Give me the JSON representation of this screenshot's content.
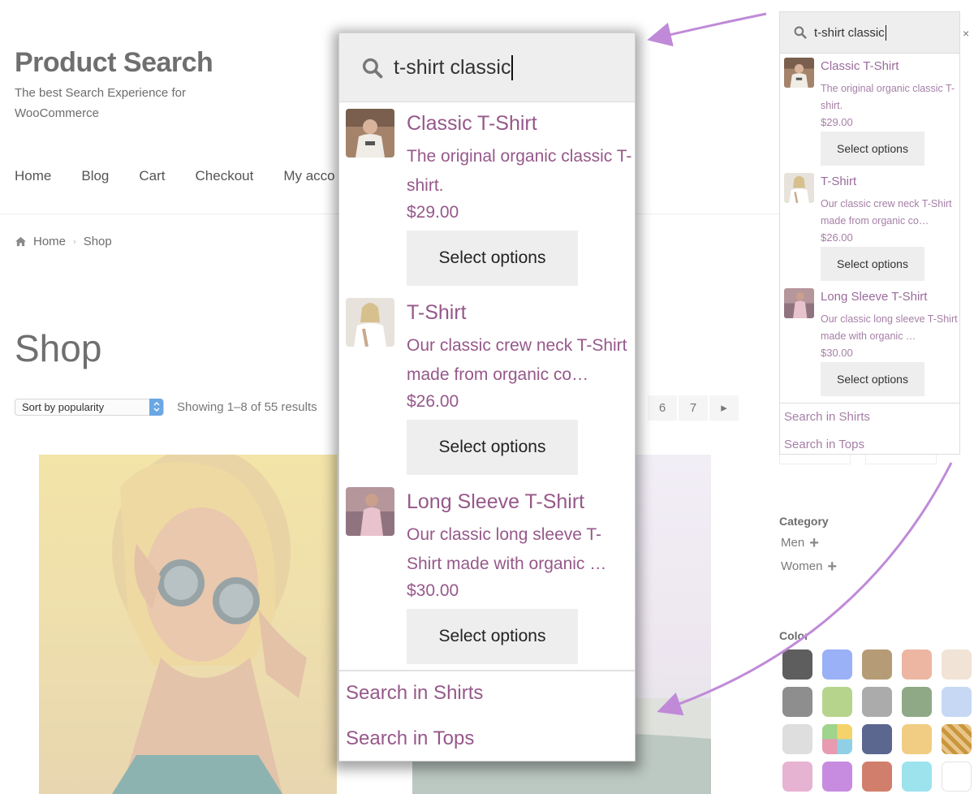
{
  "site": {
    "title": "Product Search",
    "description": "The best Search Experience for WooCommerce"
  },
  "nav": {
    "items": [
      "Home",
      "Blog",
      "Cart",
      "Checkout",
      "My acco"
    ]
  },
  "breadcrumb": {
    "home": "Home",
    "current": "Shop"
  },
  "shop": {
    "title": "Shop",
    "sort_selected": "Sort by popularity",
    "result_count": "Showing 1–8 of 55 results",
    "pages": [
      "6",
      "7"
    ]
  },
  "search": {
    "query": "t-shirt classic",
    "close": "×",
    "results": [
      {
        "name": "Classic T-Shirt",
        "desc": "The original organic classic T-shirt.",
        "price": "$29.00",
        "button": "Select options"
      },
      {
        "name": "T-Shirt",
        "desc": "Our classic crew neck T-Shirt made from organic co…",
        "price": "$26.00",
        "button": "Select options"
      },
      {
        "name": "Long Sleeve T-Shirt",
        "desc": "Our classic long sleeve T-Shirt made with organic …",
        "price": "$30.00",
        "button": "Select options"
      }
    ],
    "links": [
      "Search in Shirts",
      "Search in Tops"
    ]
  },
  "widgets": {
    "category_title": "Category",
    "categories": [
      "Men",
      "Women"
    ],
    "color_title": "Color",
    "colors": [
      "#5e5e5e",
      "#9ab0f7",
      "#b59c76",
      "#ecb6a3",
      "#f2e3d7",
      "#8e8e8e",
      "#b7d48c",
      "#ababab",
      "#8fa986",
      "#c6d8f4",
      "#dedede",
      "multicolor",
      "#5c6790",
      "#f1cc83",
      "pattern",
      "#e7b3d3",
      "#c78ce0",
      "#d17f6c",
      "#9de3ee",
      "#ffffff"
    ]
  },
  "accent": {
    "link": "#96588a",
    "arrow": "#c08ad8"
  }
}
